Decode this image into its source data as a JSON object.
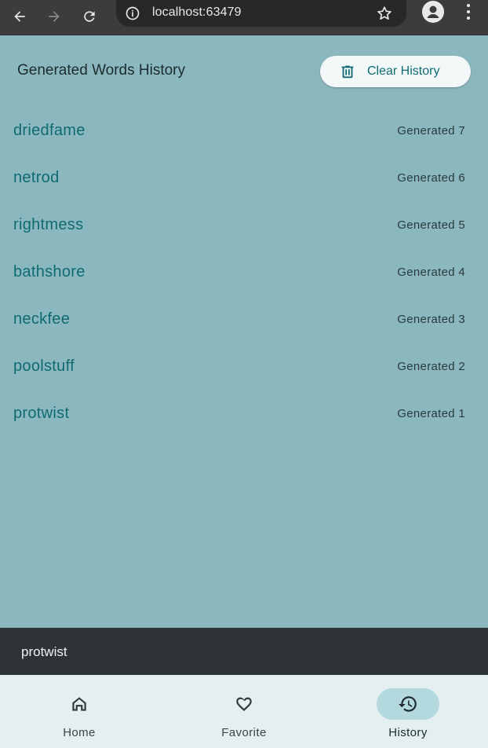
{
  "browser": {
    "url": "localhost:63479"
  },
  "header": {
    "title": "Generated Words History",
    "clear_button_label": "Clear History"
  },
  "history": [
    {
      "word": "driedfame",
      "label": "Generated 7"
    },
    {
      "word": "netrod",
      "label": "Generated 6"
    },
    {
      "word": "rightmess",
      "label": "Generated 5"
    },
    {
      "word": "bathshore",
      "label": "Generated 4"
    },
    {
      "word": "neckfee",
      "label": "Generated 3"
    },
    {
      "word": "poolstuff",
      "label": "Generated 2"
    },
    {
      "word": "protwist",
      "label": "Generated 1"
    }
  ],
  "snackbar": {
    "text": "protwist"
  },
  "bottom_nav": {
    "items": [
      {
        "label": "Home",
        "icon": "home-icon",
        "active": false
      },
      {
        "label": "Favorite",
        "icon": "heart-icon",
        "active": false
      },
      {
        "label": "History",
        "icon": "history-icon",
        "active": true
      }
    ]
  },
  "colors": {
    "accent": "#0f6a72",
    "background": "#8bb8be",
    "nav_active_pill": "#b3d8dd"
  }
}
